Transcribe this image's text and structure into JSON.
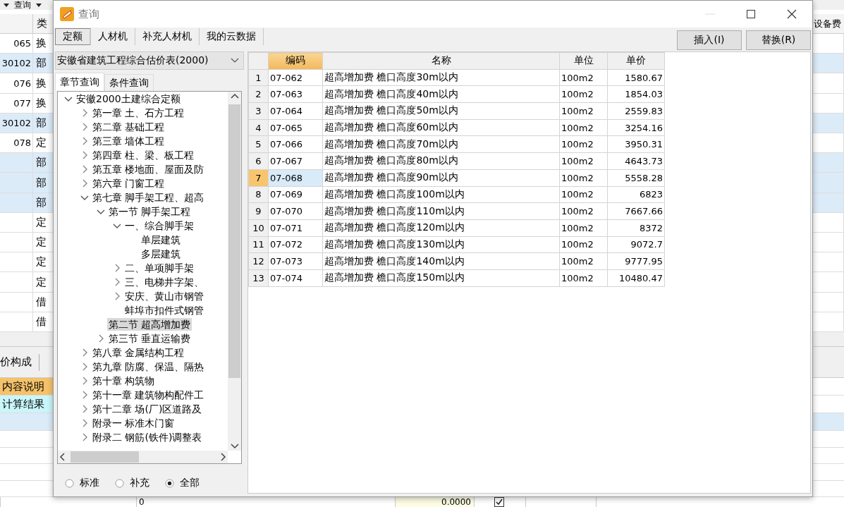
{
  "background": {
    "toolbar": {
      "menu": "查询"
    },
    "header": {
      "column_1": "类",
      "column_2": "设备费"
    },
    "rows": [
      {
        "code": "065",
        "type": "换",
        "kind": "item"
      },
      {
        "code": "30102",
        "type": "部",
        "kind": "group"
      },
      {
        "code": "076",
        "type": "换",
        "kind": "item"
      },
      {
        "code": "077",
        "type": "换",
        "kind": "item"
      },
      {
        "code": "30102",
        "type": "部",
        "kind": "group"
      },
      {
        "code": "078",
        "type": "定",
        "kind": "item"
      },
      {
        "type": "部",
        "kind": "group"
      },
      {
        "type": "部",
        "kind": "group"
      },
      {
        "type": "部",
        "kind": "group"
      },
      {
        "type": "定",
        "kind": "item"
      },
      {
        "type": "定",
        "kind": "item"
      },
      {
        "type": "定",
        "kind": "item"
      },
      {
        "type": "定",
        "kind": "item"
      },
      {
        "type": "借",
        "kind": "item"
      },
      {
        "type": "借",
        "kind": "item"
      }
    ],
    "panel_tab": "价构成",
    "detail_rows": [
      {
        "label": "内容说明",
        "kind": "header"
      },
      {
        "label": "计算结果",
        "kind": "result"
      }
    ],
    "footer_row": {
      "cell_1": "0",
      "cell_2": "0.0000",
      "checked": true
    }
  },
  "dialog": {
    "title": "查询",
    "tabs": [
      {
        "label": "定额",
        "selected": true
      },
      {
        "label": "人材机",
        "selected": false
      },
      {
        "label": "补充人材机",
        "selected": false
      },
      {
        "label": "我的云数据",
        "selected": false
      }
    ],
    "buttons": [
      "插入(I)",
      "替换(R)"
    ],
    "library": "安徽省建筑工程综合估价表(2000)",
    "subtabs": [
      {
        "label": "章节查询",
        "selected": true
      },
      {
        "label": "条件查询",
        "selected": false
      }
    ],
    "tree": [
      {
        "label": "安徽2000土建综合定额",
        "kind": "branch",
        "expanded": true,
        "selected": false,
        "children": [
          {
            "label": "第一章 土、石方工程",
            "kind": "branch",
            "expanded": false,
            "selected": false
          },
          {
            "label": "第二章 基础工程",
            "kind": "branch",
            "expanded": false,
            "selected": false
          },
          {
            "label": "第三章 墙体工程",
            "kind": "branch",
            "expanded": false,
            "selected": false
          },
          {
            "label": "第四章 柱、梁、板工程",
            "kind": "branch",
            "expanded": false,
            "selected": false
          },
          {
            "label": "第五章 楼地面、屋面及防",
            "kind": "branch",
            "expanded": false,
            "selected": false
          },
          {
            "label": "第六章 门窗工程",
            "kind": "branch",
            "expanded": false,
            "selected": false
          },
          {
            "label": "第七章 脚手架工程、超高",
            "kind": "branch",
            "expanded": true,
            "selected": false,
            "children": [
              {
                "label": "第一节 脚手架工程",
                "kind": "branch",
                "expanded": true,
                "selected": false,
                "children": [
                  {
                    "label": "一、综合脚手架",
                    "kind": "branch",
                    "expanded": true,
                    "selected": false,
                    "children": [
                      {
                        "label": "单层建筑",
                        "kind": "leaf",
                        "selected": false
                      },
                      {
                        "label": "多层建筑",
                        "kind": "leaf",
                        "selected": false
                      }
                    ]
                  },
                  {
                    "label": "二、单项脚手架",
                    "kind": "branch",
                    "expanded": false,
                    "selected": false
                  },
                  {
                    "label": "三、电梯井字架、",
                    "kind": "branch",
                    "expanded": false,
                    "selected": false
                  },
                  {
                    "label": "安庆、黄山市钢管",
                    "kind": "branch",
                    "expanded": false,
                    "selected": false
                  },
                  {
                    "label": "蚌埠市扣件式钢管",
                    "kind": "leaf",
                    "selected": false
                  }
                ]
              },
              {
                "label": "第二节 超高增加费",
                "kind": "leaf",
                "selected": true
              },
              {
                "label": "第三节 垂直运输费",
                "kind": "branch",
                "expanded": false,
                "selected": false
              }
            ]
          },
          {
            "label": "第八章 金属结构工程",
            "kind": "branch",
            "expanded": false,
            "selected": false
          },
          {
            "label": "第九章 防腐、保温、隔热",
            "kind": "branch",
            "expanded": false,
            "selected": false
          },
          {
            "label": "第十章 构筑物",
            "kind": "branch",
            "expanded": false,
            "selected": false
          },
          {
            "label": "第十一章 建筑物构配件工",
            "kind": "branch",
            "expanded": false,
            "selected": false
          },
          {
            "label": "第十二章 场(厂)区道路及",
            "kind": "branch",
            "expanded": false,
            "selected": false
          },
          {
            "label": "附录一 标准木门窗",
            "kind": "branch",
            "expanded": false,
            "selected": false
          },
          {
            "label": "附录二 钢筋(铁件)调整表",
            "kind": "branch",
            "expanded": false,
            "selected": false
          }
        ]
      }
    ],
    "radios": [
      {
        "label": "标准",
        "selected": false
      },
      {
        "label": "补充",
        "selected": false
      },
      {
        "label": "全部",
        "selected": true
      }
    ],
    "grid": {
      "columns": [
        {
          "label": "编码",
          "selected": true
        },
        {
          "label": "名称",
          "selected": false
        },
        {
          "label": "单位",
          "selected": false
        },
        {
          "label": "单价",
          "selected": false
        }
      ],
      "rows": [
        {
          "num": "1",
          "code": "07-062",
          "name": "超高增加费 檐口高度30m以内",
          "unit": "100m2",
          "price": "1580.67",
          "selected": false
        },
        {
          "num": "2",
          "code": "07-063",
          "name": "超高增加费 檐口高度40m以内",
          "unit": "100m2",
          "price": "1854.03",
          "selected": false
        },
        {
          "num": "3",
          "code": "07-064",
          "name": "超高增加费 檐口高度50m以内",
          "unit": "100m2",
          "price": "2559.83",
          "selected": false
        },
        {
          "num": "4",
          "code": "07-065",
          "name": "超高增加费 檐口高度60m以内",
          "unit": "100m2",
          "price": "3254.16",
          "selected": false
        },
        {
          "num": "5",
          "code": "07-066",
          "name": "超高增加费 檐口高度70m以内",
          "unit": "100m2",
          "price": "3950.31",
          "selected": false
        },
        {
          "num": "6",
          "code": "07-067",
          "name": "超高增加费 檐口高度80m以内",
          "unit": "100m2",
          "price": "4643.73",
          "selected": false
        },
        {
          "num": "7",
          "code": "07-068",
          "name": "超高增加费 檐口高度90m以内",
          "unit": "100m2",
          "price": "5558.28",
          "selected": true
        },
        {
          "num": "8",
          "code": "07-069",
          "name": "超高增加费 檐口高度100m以内",
          "unit": "100m2",
          "price": "6823",
          "selected": false
        },
        {
          "num": "9",
          "code": "07-070",
          "name": "超高增加费 檐口高度110m以内",
          "unit": "100m2",
          "price": "7667.66",
          "selected": false
        },
        {
          "num": "10",
          "code": "07-071",
          "name": "超高增加费 檐口高度120m以内",
          "unit": "100m2",
          "price": "8372",
          "selected": false
        },
        {
          "num": "11",
          "code": "07-072",
          "name": "超高增加费 檐口高度130m以内",
          "unit": "100m2",
          "price": "9072.7",
          "selected": false
        },
        {
          "num": "12",
          "code": "07-073",
          "name": "超高增加费 檐口高度140m以内",
          "unit": "100m2",
          "price": "9777.95",
          "selected": false
        },
        {
          "num": "13",
          "code": "07-074",
          "name": "超高增加费 檐口高度150m以内",
          "unit": "100m2",
          "price": "10480.47",
          "selected": false
        }
      ]
    }
  }
}
